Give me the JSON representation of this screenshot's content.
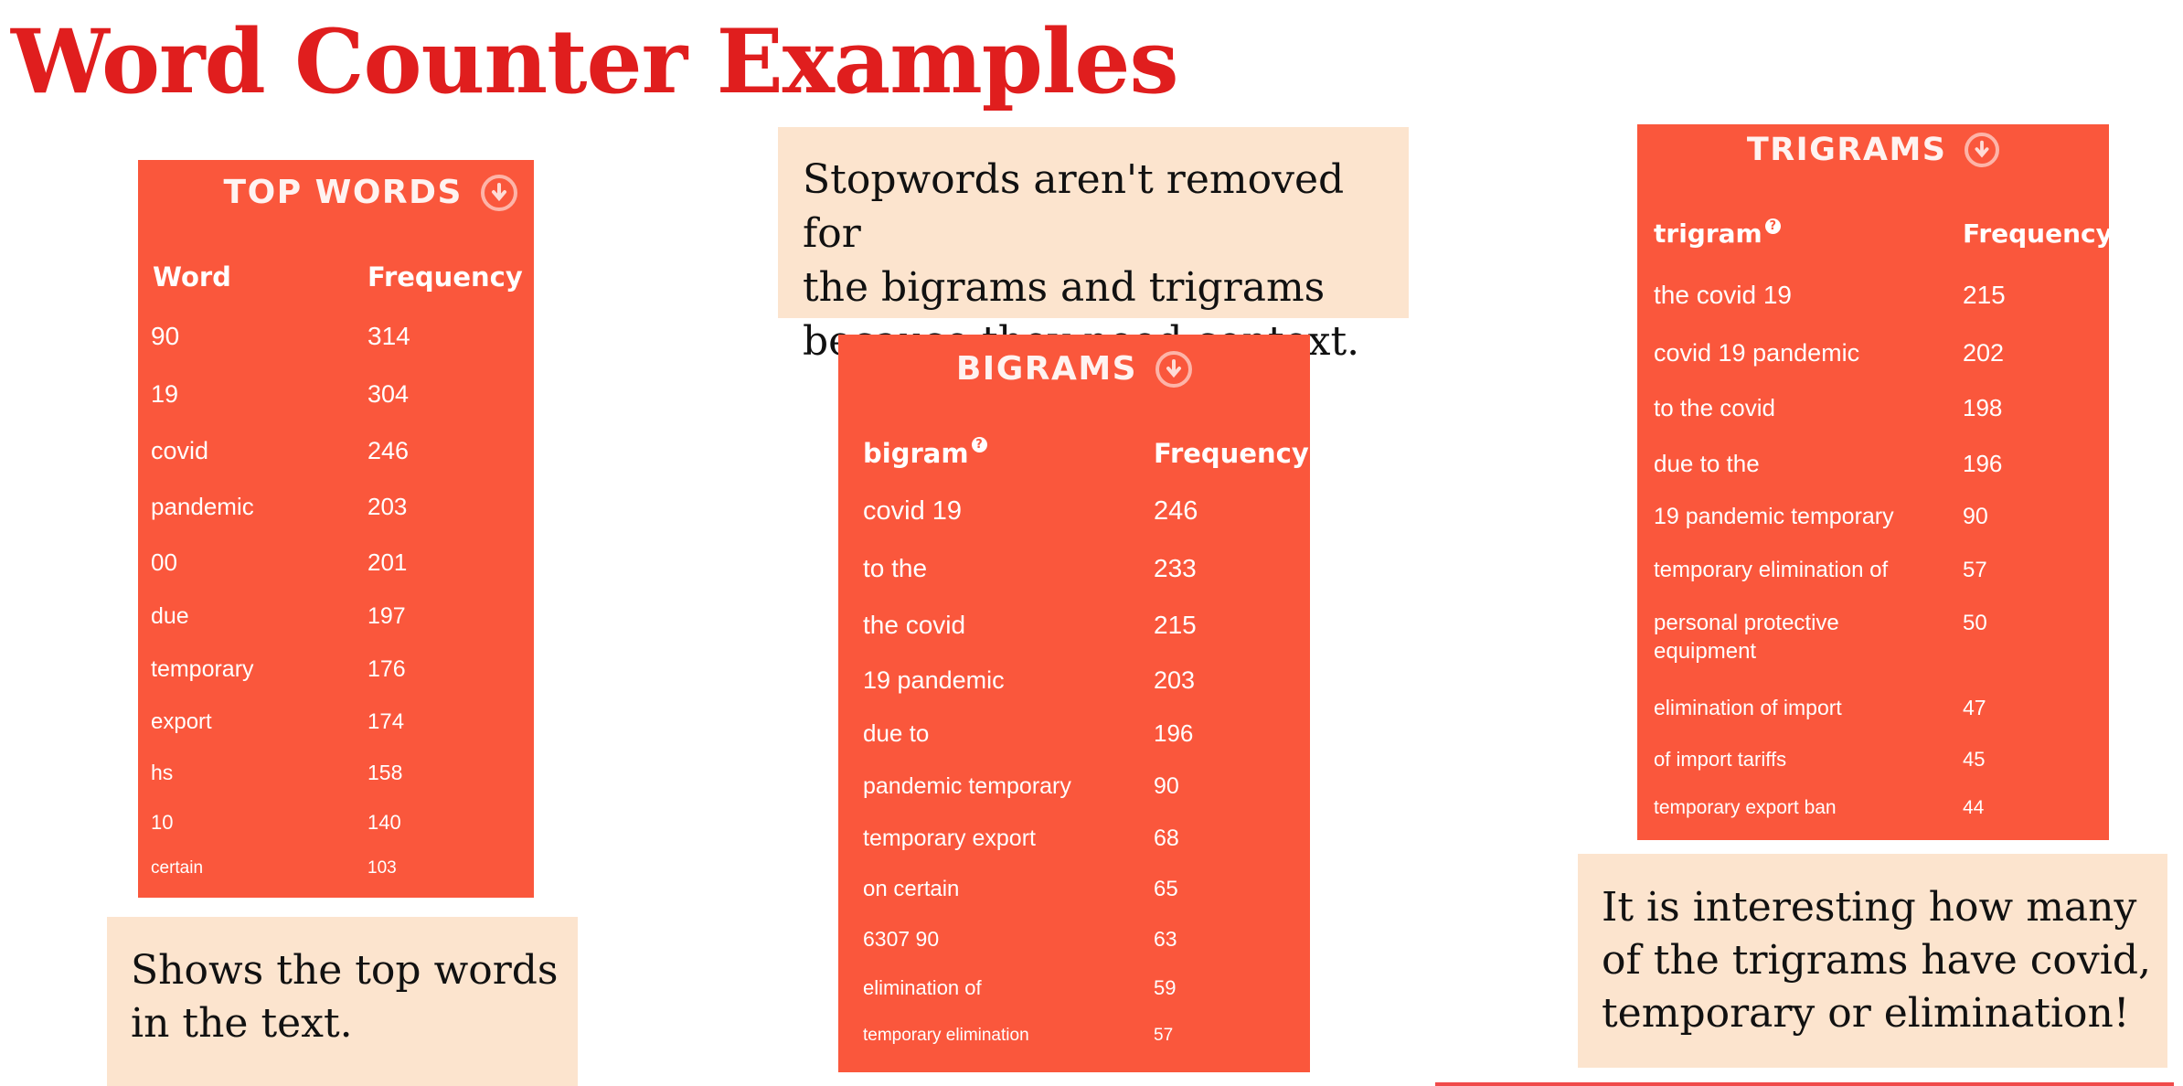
{
  "title": "Word Counter Examples",
  "colors": {
    "title": "#e01e1e",
    "panel": "#fa573c",
    "note": "#fce4ce"
  },
  "top_words": {
    "title": "TOP WORDS",
    "icon": "download-circle-icon",
    "col_word": "Word",
    "col_freq": "Frequency",
    "rows": [
      {
        "term": "90",
        "freq": "314"
      },
      {
        "term": "19",
        "freq": "304"
      },
      {
        "term": "covid",
        "freq": "246"
      },
      {
        "term": "pandemic",
        "freq": "203"
      },
      {
        "term": "00",
        "freq": "201"
      },
      {
        "term": "due",
        "freq": "197"
      },
      {
        "term": "temporary",
        "freq": "176"
      },
      {
        "term": "export",
        "freq": "174"
      },
      {
        "term": "hs",
        "freq": "158"
      },
      {
        "term": "10",
        "freq": "140"
      },
      {
        "term": "certain",
        "freq": "103"
      }
    ],
    "note": "Shows the top words\nin the text."
  },
  "bigrams": {
    "title": "BIGRAMS",
    "icon": "download-circle-icon",
    "col_word": "bigram",
    "col_help": "?",
    "col_freq": "Frequency",
    "rows": [
      {
        "term": "covid 19",
        "freq": "246"
      },
      {
        "term": "to the",
        "freq": "233"
      },
      {
        "term": "the covid",
        "freq": "215"
      },
      {
        "term": "19 pandemic",
        "freq": "203"
      },
      {
        "term": "due to",
        "freq": "196"
      },
      {
        "term": "pandemic temporary",
        "freq": "90"
      },
      {
        "term": "temporary export",
        "freq": "68"
      },
      {
        "term": "on certain",
        "freq": "65"
      },
      {
        "term": "6307 90",
        "freq": "63"
      },
      {
        "term": "elimination of",
        "freq": "59"
      },
      {
        "term": "temporary elimination",
        "freq": "57"
      }
    ],
    "note": "Stopwords aren't removed for\nthe bigrams and trigrams\nbecause they need context."
  },
  "trigrams": {
    "title": "TRIGRAMS",
    "icon": "download-circle-icon",
    "col_word": "trigram",
    "col_help": "?",
    "col_freq": "Frequency",
    "rows": [
      {
        "term": "the covid 19",
        "freq": "215"
      },
      {
        "term": "covid 19 pandemic",
        "freq": "202"
      },
      {
        "term": "to the covid",
        "freq": "198"
      },
      {
        "term": "due to the",
        "freq": "196"
      },
      {
        "term": "19 pandemic temporary",
        "freq": "90"
      },
      {
        "term": "temporary elimination of",
        "freq": "57"
      },
      {
        "term": "personal protective",
        "term2": "equipment",
        "freq": "50"
      },
      {
        "term": "elimination of import",
        "freq": "47"
      },
      {
        "term": "of import tariffs",
        "freq": "45"
      },
      {
        "term": "temporary export ban",
        "freq": "44"
      }
    ],
    "note": "It is interesting how many\nof the trigrams have covid,\ntemporary or elimination!"
  }
}
